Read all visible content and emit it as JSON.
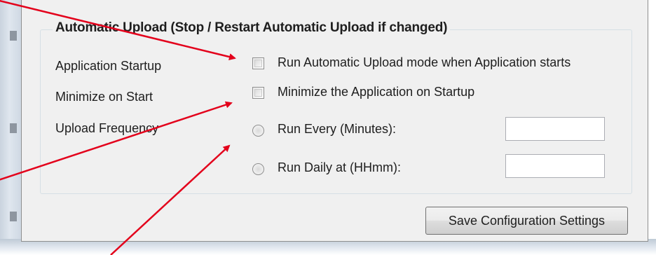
{
  "group": {
    "title": "Automatic Upload (Stop / Restart Automatic Upload if changed)"
  },
  "rows": {
    "startup_label": "Application Startup",
    "minimize_label": "Minimize on Start",
    "frequency_label": "Upload Frequency"
  },
  "options": {
    "run_on_start": "Run Automatic Upload mode when Application starts",
    "minimize_on_startup": "Minimize the Application on Startup",
    "run_every": "Run Every (Minutes):",
    "run_daily": "Run Daily at (HHmm):"
  },
  "inputs": {
    "run_every_value": "",
    "run_daily_value": ""
  },
  "buttons": {
    "save": "Save Configuration Settings"
  },
  "colors": {
    "annotation_arrow": "#e3001b",
    "panel_background": "#f0f0f0"
  }
}
